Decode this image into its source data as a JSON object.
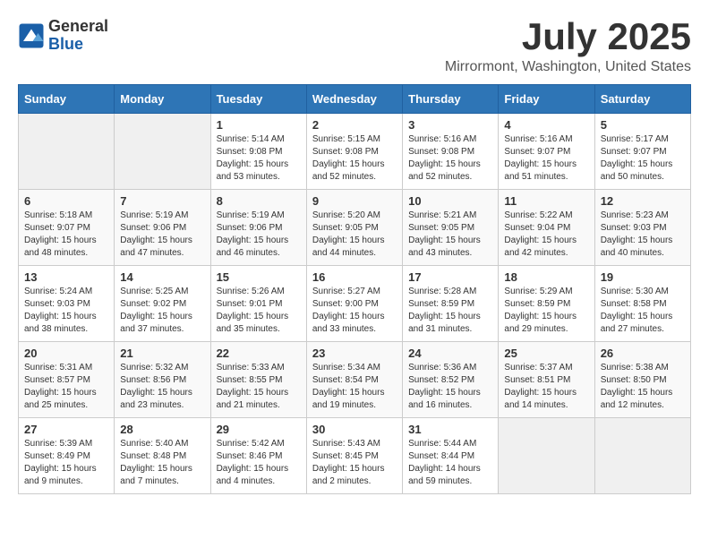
{
  "header": {
    "logo": {
      "general": "General",
      "blue": "Blue"
    },
    "title": "July 2025",
    "subtitle": "Mirrormont, Washington, United States"
  },
  "calendar": {
    "weekdays": [
      "Sunday",
      "Monday",
      "Tuesday",
      "Wednesday",
      "Thursday",
      "Friday",
      "Saturday"
    ],
    "weeks": [
      [
        {
          "day": "",
          "info": ""
        },
        {
          "day": "",
          "info": ""
        },
        {
          "day": "1",
          "info": "Sunrise: 5:14 AM\nSunset: 9:08 PM\nDaylight: 15 hours and 53 minutes."
        },
        {
          "day": "2",
          "info": "Sunrise: 5:15 AM\nSunset: 9:08 PM\nDaylight: 15 hours and 52 minutes."
        },
        {
          "day": "3",
          "info": "Sunrise: 5:16 AM\nSunset: 9:08 PM\nDaylight: 15 hours and 52 minutes."
        },
        {
          "day": "4",
          "info": "Sunrise: 5:16 AM\nSunset: 9:07 PM\nDaylight: 15 hours and 51 minutes."
        },
        {
          "day": "5",
          "info": "Sunrise: 5:17 AM\nSunset: 9:07 PM\nDaylight: 15 hours and 50 minutes."
        }
      ],
      [
        {
          "day": "6",
          "info": "Sunrise: 5:18 AM\nSunset: 9:07 PM\nDaylight: 15 hours and 48 minutes."
        },
        {
          "day": "7",
          "info": "Sunrise: 5:19 AM\nSunset: 9:06 PM\nDaylight: 15 hours and 47 minutes."
        },
        {
          "day": "8",
          "info": "Sunrise: 5:19 AM\nSunset: 9:06 PM\nDaylight: 15 hours and 46 minutes."
        },
        {
          "day": "9",
          "info": "Sunrise: 5:20 AM\nSunset: 9:05 PM\nDaylight: 15 hours and 44 minutes."
        },
        {
          "day": "10",
          "info": "Sunrise: 5:21 AM\nSunset: 9:05 PM\nDaylight: 15 hours and 43 minutes."
        },
        {
          "day": "11",
          "info": "Sunrise: 5:22 AM\nSunset: 9:04 PM\nDaylight: 15 hours and 42 minutes."
        },
        {
          "day": "12",
          "info": "Sunrise: 5:23 AM\nSunset: 9:03 PM\nDaylight: 15 hours and 40 minutes."
        }
      ],
      [
        {
          "day": "13",
          "info": "Sunrise: 5:24 AM\nSunset: 9:03 PM\nDaylight: 15 hours and 38 minutes."
        },
        {
          "day": "14",
          "info": "Sunrise: 5:25 AM\nSunset: 9:02 PM\nDaylight: 15 hours and 37 minutes."
        },
        {
          "day": "15",
          "info": "Sunrise: 5:26 AM\nSunset: 9:01 PM\nDaylight: 15 hours and 35 minutes."
        },
        {
          "day": "16",
          "info": "Sunrise: 5:27 AM\nSunset: 9:00 PM\nDaylight: 15 hours and 33 minutes."
        },
        {
          "day": "17",
          "info": "Sunrise: 5:28 AM\nSunset: 8:59 PM\nDaylight: 15 hours and 31 minutes."
        },
        {
          "day": "18",
          "info": "Sunrise: 5:29 AM\nSunset: 8:59 PM\nDaylight: 15 hours and 29 minutes."
        },
        {
          "day": "19",
          "info": "Sunrise: 5:30 AM\nSunset: 8:58 PM\nDaylight: 15 hours and 27 minutes."
        }
      ],
      [
        {
          "day": "20",
          "info": "Sunrise: 5:31 AM\nSunset: 8:57 PM\nDaylight: 15 hours and 25 minutes."
        },
        {
          "day": "21",
          "info": "Sunrise: 5:32 AM\nSunset: 8:56 PM\nDaylight: 15 hours and 23 minutes."
        },
        {
          "day": "22",
          "info": "Sunrise: 5:33 AM\nSunset: 8:55 PM\nDaylight: 15 hours and 21 minutes."
        },
        {
          "day": "23",
          "info": "Sunrise: 5:34 AM\nSunset: 8:54 PM\nDaylight: 15 hours and 19 minutes."
        },
        {
          "day": "24",
          "info": "Sunrise: 5:36 AM\nSunset: 8:52 PM\nDaylight: 15 hours and 16 minutes."
        },
        {
          "day": "25",
          "info": "Sunrise: 5:37 AM\nSunset: 8:51 PM\nDaylight: 15 hours and 14 minutes."
        },
        {
          "day": "26",
          "info": "Sunrise: 5:38 AM\nSunset: 8:50 PM\nDaylight: 15 hours and 12 minutes."
        }
      ],
      [
        {
          "day": "27",
          "info": "Sunrise: 5:39 AM\nSunset: 8:49 PM\nDaylight: 15 hours and 9 minutes."
        },
        {
          "day": "28",
          "info": "Sunrise: 5:40 AM\nSunset: 8:48 PM\nDaylight: 15 hours and 7 minutes."
        },
        {
          "day": "29",
          "info": "Sunrise: 5:42 AM\nSunset: 8:46 PM\nDaylight: 15 hours and 4 minutes."
        },
        {
          "day": "30",
          "info": "Sunrise: 5:43 AM\nSunset: 8:45 PM\nDaylight: 15 hours and 2 minutes."
        },
        {
          "day": "31",
          "info": "Sunrise: 5:44 AM\nSunset: 8:44 PM\nDaylight: 14 hours and 59 minutes."
        },
        {
          "day": "",
          "info": ""
        },
        {
          "day": "",
          "info": ""
        }
      ]
    ]
  }
}
